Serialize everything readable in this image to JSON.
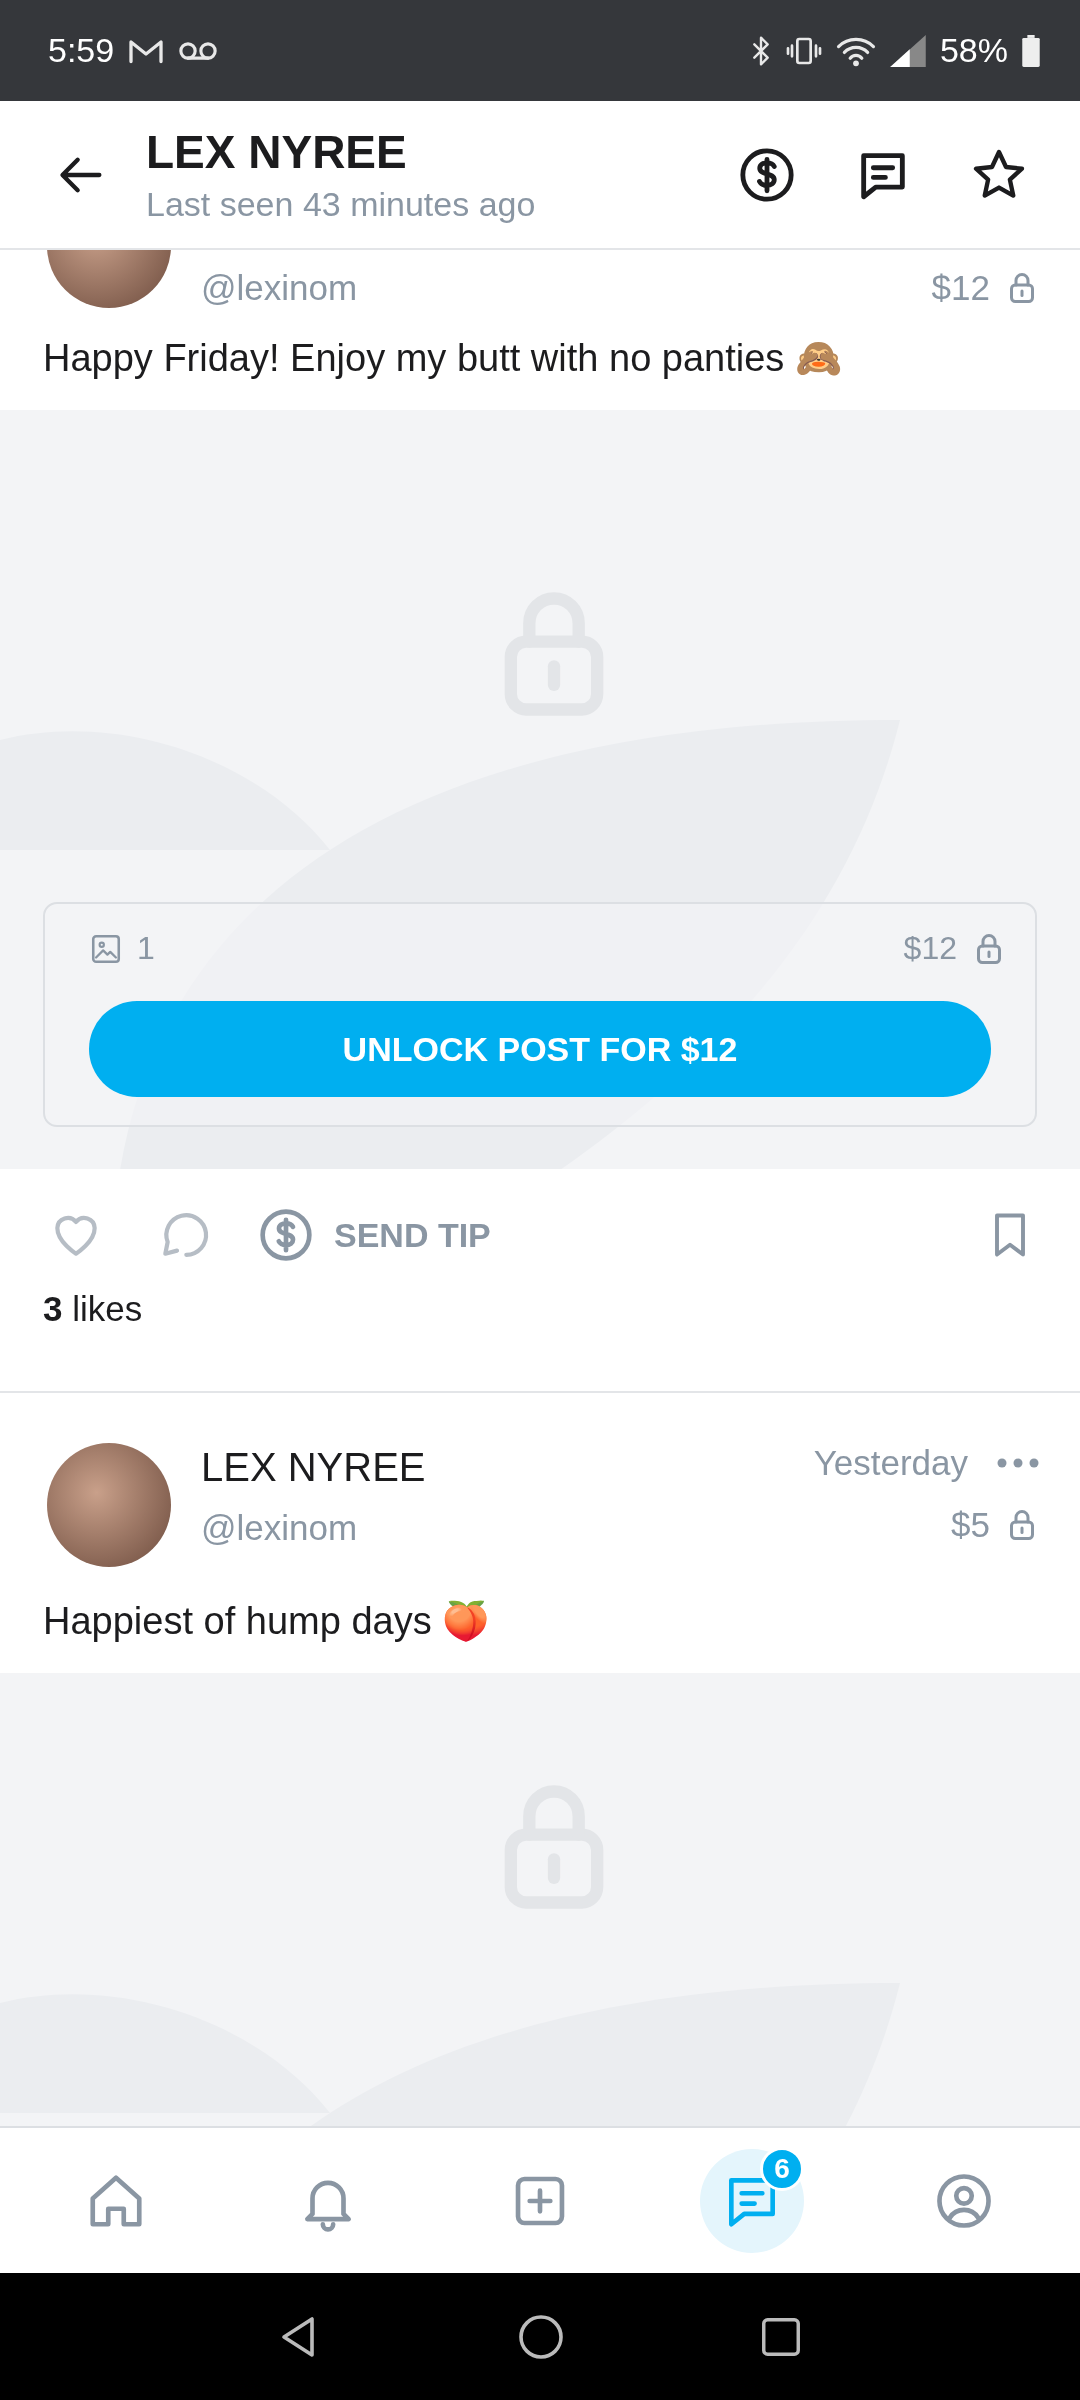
{
  "status_bar": {
    "time": "5:59",
    "battery": "58%"
  },
  "header": {
    "title": "LEX NYREE",
    "subtitle": "Last seen 43 minutes ago"
  },
  "posts": [
    {
      "handle": "@lexinom",
      "price": "$12",
      "caption": "Happy Friday! Enjoy my butt with no panties 🙈",
      "unlock": {
        "media_count": "1",
        "price": "$12",
        "button": "UNLOCK POST FOR $12"
      },
      "tip": "SEND TIP",
      "likes": "**3** likes"
    },
    {
      "name": "LEX NYREE",
      "handle": "@lexinom",
      "time": "Yesterday",
      "price": "$5",
      "caption": "Happiest of hump days 🍑"
    }
  ],
  "bottom_nav": [
    {
      "kind": "home",
      "selected": false
    },
    {
      "kind": "notifications",
      "selected": false
    },
    {
      "kind": "add",
      "selected": false
    },
    {
      "kind": "messages",
      "selected": true,
      "badge": "6"
    },
    {
      "kind": "profile",
      "selected": false
    }
  ]
}
